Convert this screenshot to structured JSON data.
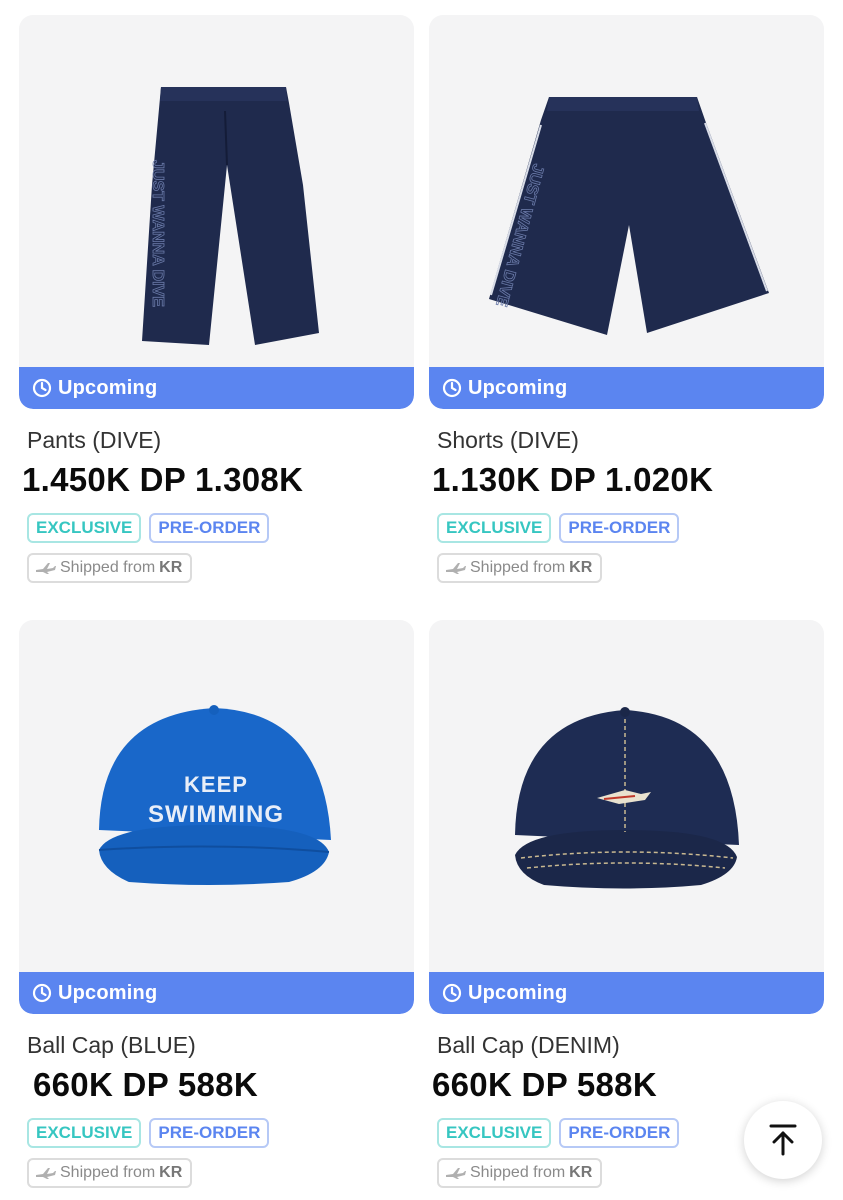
{
  "products": [
    {
      "image": "navy-wide-pants",
      "status": "Upcoming",
      "name": "Pants (DIVE)",
      "price": "1.450K DP 1.308K",
      "badges": [
        "EXCLUSIVE",
        "PRE-ORDER"
      ],
      "shipping_prefix": "Shipped from",
      "shipping_country": "KR"
    },
    {
      "image": "navy-shorts",
      "status": "Upcoming",
      "name": "Shorts (DIVE)",
      "price": "1.130K DP 1.020K",
      "badges": [
        "EXCLUSIVE",
        "PRE-ORDER"
      ],
      "shipping_prefix": "Shipped from",
      "shipping_country": "KR"
    },
    {
      "image": "blue-ball-cap",
      "image_text": [
        "KEEP",
        "SWIMMING"
      ],
      "status": "Upcoming",
      "name": "Ball Cap (BLUE)",
      "price": "660K DP 588K",
      "badges": [
        "EXCLUSIVE",
        "PRE-ORDER"
      ],
      "shipping_prefix": "Shipped from",
      "shipping_country": "KR"
    },
    {
      "image": "denim-ball-cap",
      "status": "Upcoming",
      "name": "Ball Cap (DENIM)",
      "price": "660K DP 588K",
      "badges": [
        "EXCLUSIVE",
        "PRE-ORDER"
      ],
      "shipping_prefix": "Shipped from",
      "shipping_country": "KR"
    }
  ],
  "pants_print": "JUST WANNA DIVE",
  "icons": {
    "status": "clock-icon",
    "shipping": "plane-icon",
    "scroll_top": "arrow-up-icon"
  },
  "colors": {
    "status_bar": "#5b85f0",
    "exclusive": "#36c6c1",
    "preorder": "#5b85f0"
  }
}
